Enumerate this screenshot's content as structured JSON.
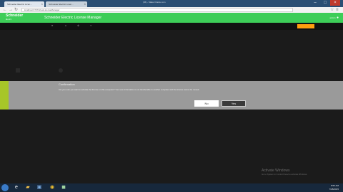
{
  "browser": {
    "tabs": [
      {
        "label": "Schneider Electric Licen..."
      },
      {
        "label": "Schneider Electric Licen..."
      }
    ],
    "window_title": "(36) - Make Oracle.com",
    "url": "localhost:3737/showLicenseManager"
  },
  "app": {
    "logo_name": "Schneider",
    "logo_sub": "Electric",
    "title": "Schneider Electric License Manager",
    "user_label": "admin"
  },
  "dialog": {
    "title": "Confirmation",
    "text": "Are you sure you want to activate the license on this computer? Your user information is not transferable to another computer and the license cannot be moved.",
    "no_label": "No",
    "yes_label": "Yes"
  },
  "watermark": {
    "title": "Activate Windows",
    "subtitle": "Go to System in Control Panel to activate Windows."
  },
  "taskbar": {
    "time": "8:55 AM",
    "date": "7/28/2015"
  },
  "colors": {
    "brand_green": "#3dcd58",
    "accent_lime": "#a7c628",
    "taskbar": "#17283c"
  }
}
